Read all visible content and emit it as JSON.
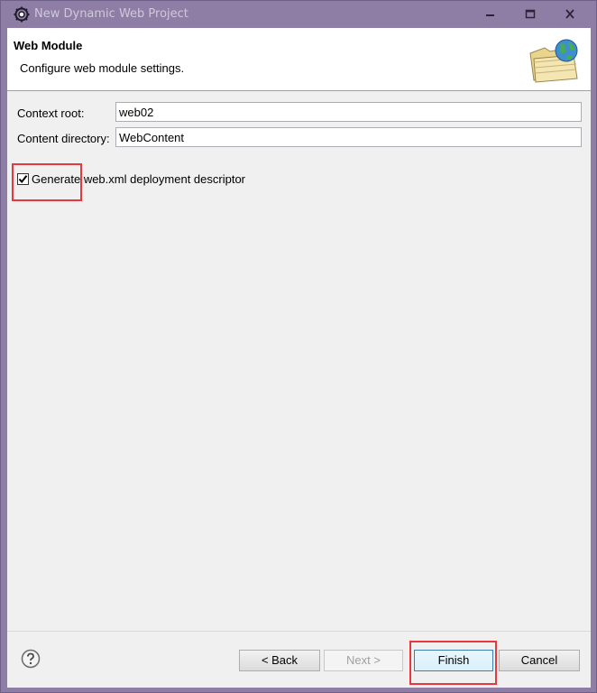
{
  "window": {
    "title": "New Dynamic Web Project",
    "minimize_icon": "minimize-icon",
    "maximize_icon": "maximize-icon",
    "close_icon": "close-icon"
  },
  "banner": {
    "title": "Web Module",
    "subtitle": "Configure web module settings.",
    "icon": "web-folder-globe-icon"
  },
  "fields": {
    "context_root": {
      "label": "Context root:",
      "value": "web02"
    },
    "content_directory": {
      "label": "Content directory:",
      "value": "WebContent"
    }
  },
  "generate_descriptor": {
    "label": "Generate web.xml deployment descriptor",
    "checked": true
  },
  "buttons": {
    "back": "< Back",
    "next": "Next >",
    "finish": "Finish",
    "cancel": "Cancel"
  },
  "help_icon": "help-icon",
  "colors": {
    "highlight": "#e8383d",
    "titlebar": "#8e7ea6"
  }
}
